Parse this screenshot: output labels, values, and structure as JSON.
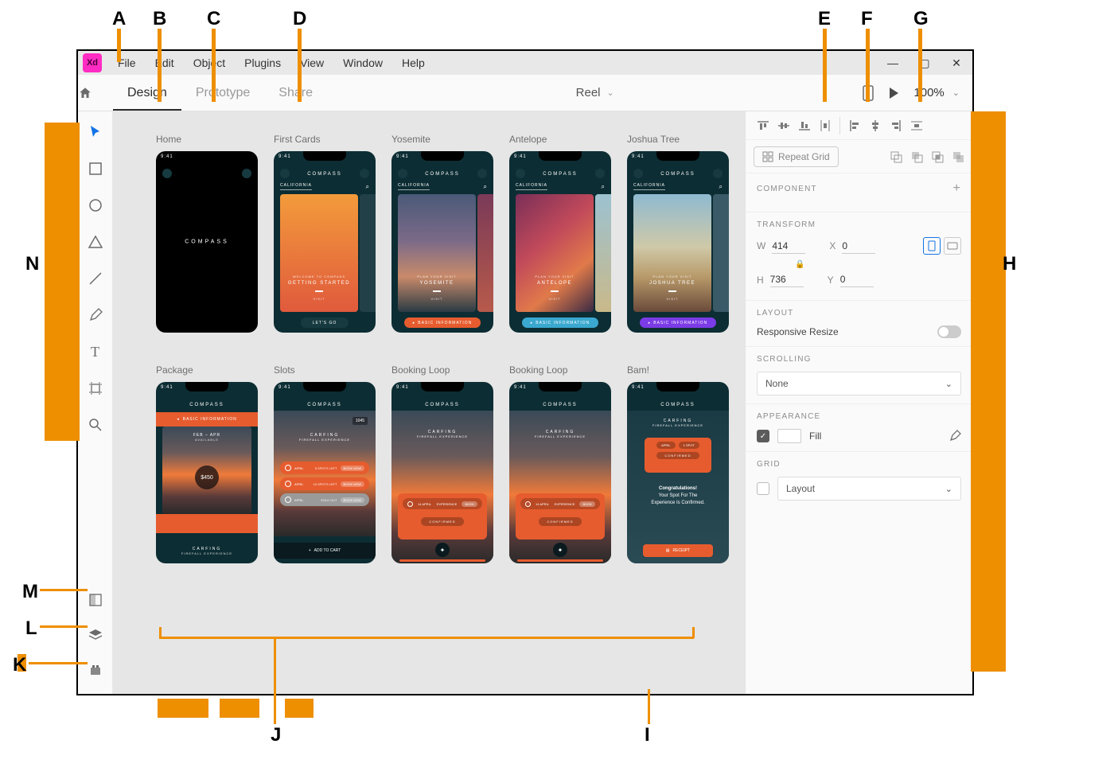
{
  "callouts": {
    "A": "A",
    "B": "B",
    "C": "C",
    "D": "D",
    "E": "E",
    "F": "F",
    "G": "G",
    "H": "H",
    "I": "I",
    "J": "J",
    "K": "K",
    "L": "L",
    "M": "M",
    "N": "N"
  },
  "menubar": {
    "logo": "Xd",
    "items": [
      "File",
      "Edit",
      "Object",
      "Plugins",
      "View",
      "Window",
      "Help"
    ]
  },
  "modebar": {
    "modes": [
      "Design",
      "Prototype",
      "Share"
    ],
    "activeMode": "Design",
    "docTitle": "Reel",
    "zoom": "100%"
  },
  "tools": [
    "select",
    "rectangle",
    "ellipse",
    "triangle",
    "line",
    "pen",
    "text",
    "artboard",
    "zoom"
  ],
  "bottomTools": [
    "assets",
    "layers",
    "plugins"
  ],
  "artboards": {
    "row1": [
      {
        "label": "Home",
        "type": "splash",
        "brand": "COMPASS"
      },
      {
        "label": "First Cards",
        "type": "card",
        "brand": "COMPASS",
        "tag": "CALIFORNIA",
        "sub": "WELCOME TO COMPASS",
        "title": "GETTING STARTED",
        "cta": "LET'S GO",
        "cardStyle": "orange-grad"
      },
      {
        "label": "Yosemite",
        "type": "card",
        "brand": "COMPASS",
        "tag": "CALIFORNIA",
        "sub": "PLAN YOUR VISIT",
        "title": "YOSEMITE",
        "cta": "BASIC INFORMATION",
        "cardStyle": "photo-sunset",
        "pillColor": "#e65c2e"
      },
      {
        "label": "Antelope",
        "type": "card",
        "brand": "COMPASS",
        "tag": "CALIFORNIA",
        "sub": "PLAN YOUR VISIT",
        "title": "ANTELOPE",
        "cta": "BASIC INFORMATION",
        "cardStyle": "photo-canyon",
        "pillColor": "#3aa8cf"
      },
      {
        "label": "Joshua Tree",
        "type": "card",
        "brand": "COMPASS",
        "tag": "CALIFORNIA",
        "sub": "PLAN YOUR VISIT",
        "title": "JOSHUA TREE",
        "cta": "BASIC INFORMATION",
        "cardStyle": "photo-desert",
        "pillColor": "#7b3be6"
      }
    ],
    "row2": [
      {
        "label": "Package",
        "type": "detail",
        "brand": "COMPASS",
        "hero": "BASIC INFORMATION",
        "dates": "FEB – APR",
        "avail": "AVAILABLE",
        "price": "$450",
        "footTitle": "CARFING",
        "footSub": "FIREFALL EXPERIENCE"
      },
      {
        "label": "Slots",
        "type": "slots",
        "brand": "COMPASS",
        "top": "1045",
        "carf": "CARFING",
        "exp": "FIREFALL EXPERIENCE",
        "rows": [
          {
            "m": "APRIL",
            "a": "5 SPOTS LEFT",
            "b": "BOOK NOW"
          },
          {
            "m": "APRIL",
            "a": "10 SPOTS LEFT",
            "b": "BOOK NOW"
          },
          {
            "m": "APRIL",
            "a": "SOLD OUT",
            "b": "BOOK NOW"
          }
        ],
        "bottom": "ADD TO CART"
      },
      {
        "label": "Booking Loop",
        "type": "book",
        "brand": "COMPASS",
        "carf": "CARFING",
        "exp": "FIREFALL EXPERIENCE",
        "rowM": "14 APRIL",
        "rowB": "EXPERIENCE",
        "status": "CONFIRMED"
      },
      {
        "label": "Booking Loop",
        "type": "book",
        "brand": "COMPASS",
        "carf": "CARFING",
        "exp": "FIREFALL EXPERIENCE",
        "rowM": "14 APRIL",
        "rowB": "EXPERIENCE",
        "status": "CONFIRMED"
      },
      {
        "label": "Bam!",
        "type": "bam",
        "brand": "COMPASS",
        "carf": "CARFING",
        "exp": "FIREFALL EXPERIENCE",
        "chip1": "APRIL",
        "chip2": "1 SPOT",
        "cta": "CONFIRMED",
        "msg1": "Congratulations!",
        "msg2": "Your Spot For The",
        "msg3": "Experience Is Confirmed.",
        "receipt": "RECEIPT"
      }
    ]
  },
  "props": {
    "repeatGrid": "Repeat Grid",
    "component": "COMPONENT",
    "transform": {
      "label": "TRANSFORM",
      "w": "414",
      "h": "736",
      "x": "0",
      "y": "0",
      "wl": "W",
      "hl": "H",
      "xl": "X",
      "yl": "Y"
    },
    "layout": {
      "label": "LAYOUT",
      "responsive": "Responsive Resize"
    },
    "scrolling": {
      "label": "SCROLLING",
      "value": "None"
    },
    "appearance": {
      "label": "APPEARANCE",
      "fill": "Fill"
    },
    "grid": {
      "label": "GRID",
      "value": "Layout"
    }
  }
}
